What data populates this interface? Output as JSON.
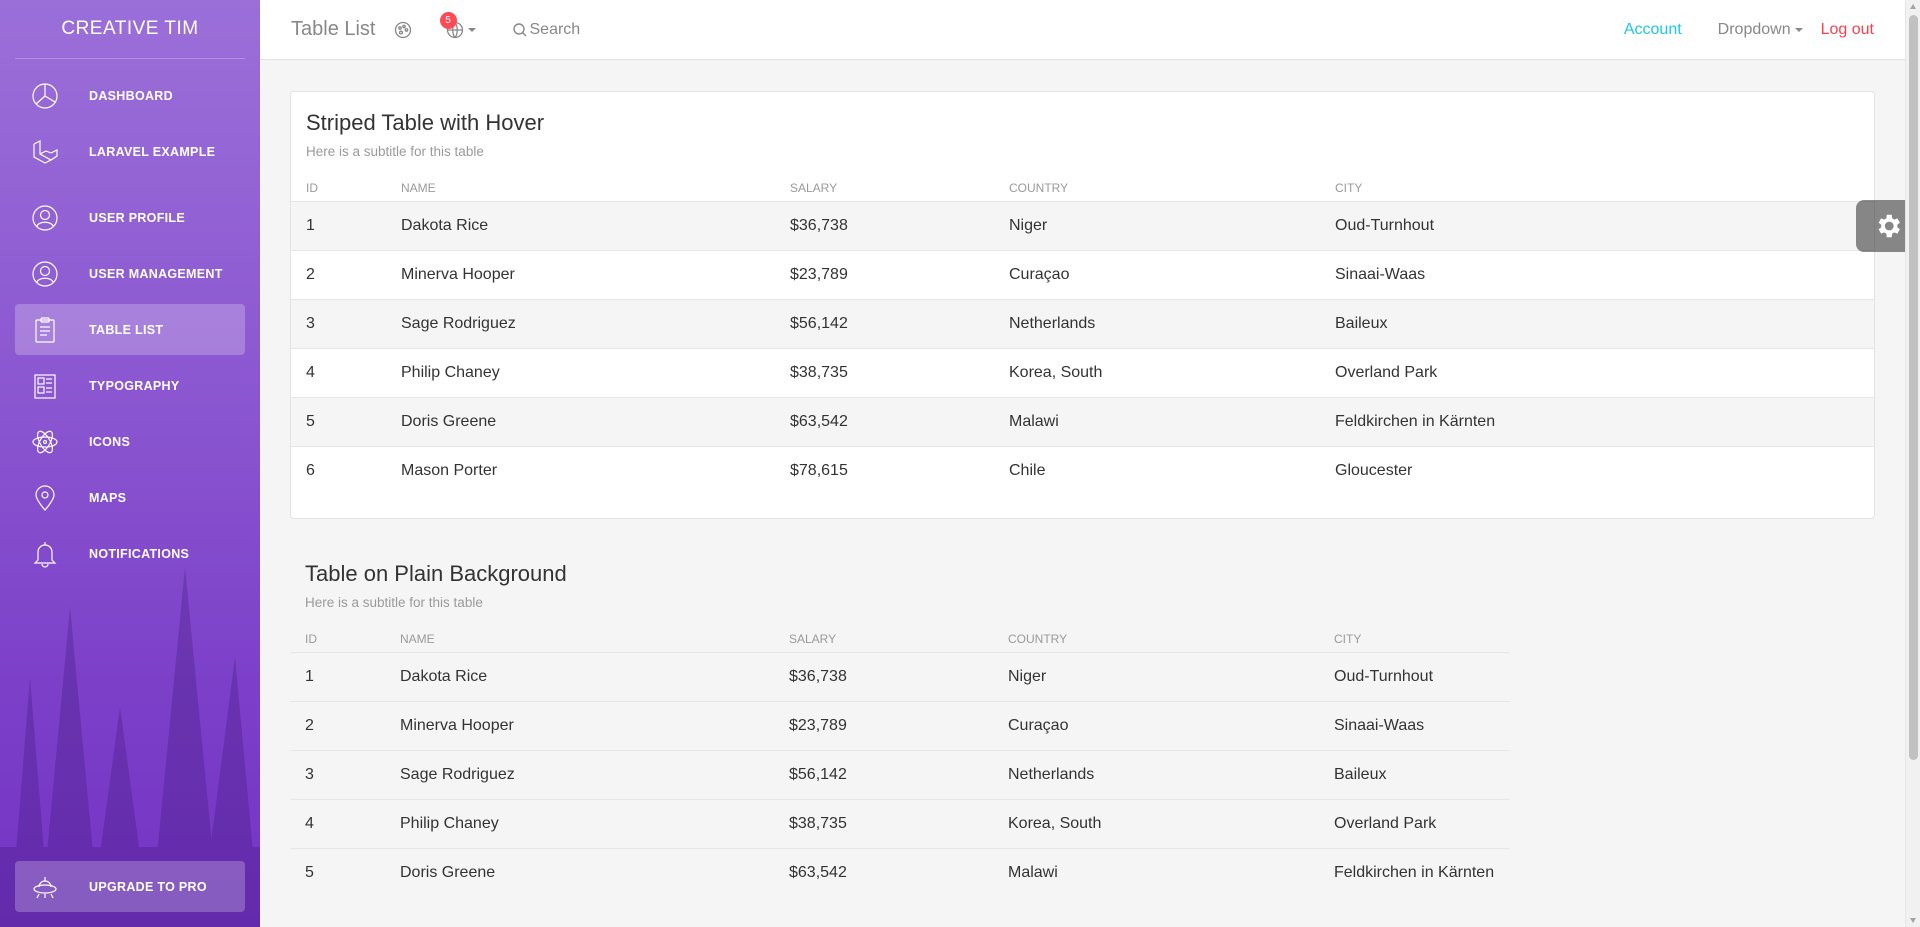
{
  "sidebar": {
    "brand": "CREATIVE TIM",
    "items": [
      {
        "label": "DASHBOARD",
        "icon": "pie-chart-icon",
        "active": false
      },
      {
        "label": "LARAVEL EXAMPLE",
        "icon": "laravel-icon",
        "active": false
      },
      {
        "label": "USER PROFILE",
        "icon": "user-circle-icon",
        "active": false
      },
      {
        "label": "USER MANAGEMENT",
        "icon": "user-circle-icon",
        "active": false
      },
      {
        "label": "TABLE LIST",
        "icon": "clipboard-icon",
        "active": true
      },
      {
        "label": "TYPOGRAPHY",
        "icon": "paper-icon",
        "active": false
      },
      {
        "label": "ICONS",
        "icon": "atom-icon",
        "active": false
      },
      {
        "label": "MAPS",
        "icon": "map-pin-icon",
        "active": false
      },
      {
        "label": "NOTIFICATIONS",
        "icon": "bell-icon",
        "active": false
      }
    ],
    "upgrade": {
      "label": "UPGRADE TO PRO",
      "icon": "alien-ship-icon"
    }
  },
  "navbar": {
    "title": "Table List",
    "notification_count": "5",
    "search_placeholder": "Search",
    "account": "Account",
    "dropdown": "Dropdown",
    "logout": "Log out"
  },
  "colors": {
    "accent_info": "#1dc7ea",
    "accent_danger": "#fb404b",
    "sidebar_purple": "#8a55d0"
  },
  "tables": {
    "striped": {
      "title": "Striped Table with Hover",
      "subtitle": "Here is a subtitle for this table",
      "columns": [
        "ID",
        "NAME",
        "SALARY",
        "COUNTRY",
        "CITY"
      ],
      "rows": [
        [
          "1",
          "Dakota Rice",
          "$36,738",
          "Niger",
          "Oud-Turnhout"
        ],
        [
          "2",
          "Minerva Hooper",
          "$23,789",
          "Curaçao",
          "Sinaai-Waas"
        ],
        [
          "3",
          "Sage Rodriguez",
          "$56,142",
          "Netherlands",
          "Baileux"
        ],
        [
          "4",
          "Philip Chaney",
          "$38,735",
          "Korea, South",
          "Overland Park"
        ],
        [
          "5",
          "Doris Greene",
          "$63,542",
          "Malawi",
          "Feldkirchen in Kärnten"
        ],
        [
          "6",
          "Mason Porter",
          "$78,615",
          "Chile",
          "Gloucester"
        ]
      ]
    },
    "plain": {
      "title": "Table on Plain Background",
      "subtitle": "Here is a subtitle for this table",
      "columns": [
        "ID",
        "NAME",
        "SALARY",
        "COUNTRY",
        "CITY"
      ],
      "rows": [
        [
          "1",
          "Dakota Rice",
          "$36,738",
          "Niger",
          "Oud-Turnhout"
        ],
        [
          "2",
          "Minerva Hooper",
          "$23,789",
          "Curaçao",
          "Sinaai-Waas"
        ],
        [
          "3",
          "Sage Rodriguez",
          "$56,142",
          "Netherlands",
          "Baileux"
        ],
        [
          "4",
          "Philip Chaney",
          "$38,735",
          "Korea, South",
          "Overland Park"
        ],
        [
          "5",
          "Doris Greene",
          "$63,542",
          "Malawi",
          "Feldkirchen in Kärnten"
        ]
      ]
    }
  }
}
